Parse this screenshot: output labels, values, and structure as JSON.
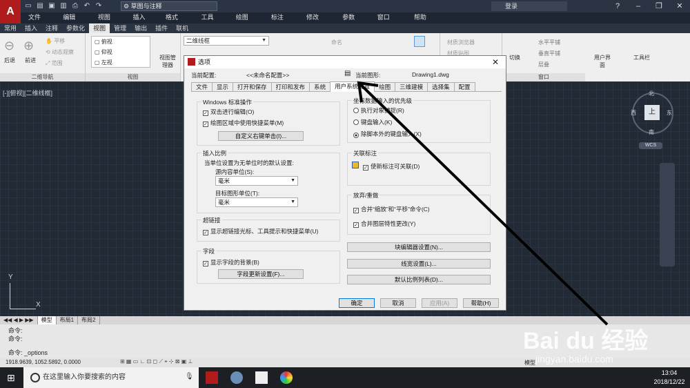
{
  "app": {
    "logo": "A",
    "workspace": "草图与注释",
    "login": "登录",
    "help": "?"
  },
  "menu": [
    "文件(F)",
    "编辑(E)",
    "视图(V)",
    "插入(I)",
    "格式(O)",
    "工具(T)",
    "绘图(D)",
    "标注(N)",
    "修改(M)",
    "参数(P)",
    "窗口(W)",
    "帮助(H)"
  ],
  "ribbon_tabs": [
    "常用",
    "插入",
    "注释",
    "参数化",
    "视图",
    "管理",
    "输出",
    "插件",
    "联机"
  ],
  "ribbon_active": "视图",
  "ribbon": {
    "nav_back": "后退",
    "nav_fwd": "前进",
    "pan": "平移",
    "orbit": "动态观察",
    "range": "范围",
    "panel_nav": "二维导航",
    "view_top": "俯视",
    "view_bottom": "仰视",
    "view_left": "左视",
    "view_mgr": "视图管理器",
    "panel_view": "视图",
    "visual_style": "二维线框",
    "named": "命名",
    "mat_browser": "材质浏览器",
    "mat_map": "材质贴图",
    "switch": "切换",
    "horiz": "水平平铺",
    "vert": "垂直平铺",
    "cascade": "层叠",
    "user_iface": "用户界面",
    "toolbar": "工具栏",
    "panel_window": "窗口"
  },
  "viewport": {
    "label": "[-][俯视][二维线框]",
    "north": "北",
    "south": "南",
    "east": "东",
    "west": "西",
    "cube": "上",
    "wcs": "WCS",
    "ucs_y": "Y",
    "ucs_x": "X"
  },
  "layout_tabs": [
    "模型",
    "布局1",
    "布局2"
  ],
  "commands": [
    "命令:",
    "命令:",
    "命令:  _options"
  ],
  "status": {
    "coords": "1918.9639,  1052.5892,  0.0000",
    "model": "模型"
  },
  "taskbar": {
    "search": "在这里输入你要搜索的内容",
    "time": "13:04",
    "date": "2018/12/22"
  },
  "watermark": {
    "brand": "Bai du 经验",
    "url": "jingyan.baidu.com"
  },
  "dialog": {
    "title": "选项",
    "current_profile_label": "当前配置:",
    "current_profile": "<<未命名配置>>",
    "current_drawing_label": "当前图形:",
    "current_drawing": "Drawing1.dwg",
    "tabs": [
      "文件",
      "显示",
      "打开和保存",
      "打印和发布",
      "系统",
      "用户系统配置",
      "绘图",
      "三维建模",
      "选择集",
      "配置"
    ],
    "active_tab": "用户系统配置",
    "windows_group": "Windows 标准操作",
    "dblclick": "双击进行编辑(O)",
    "shortcut": "绘图区域中使用快捷菜单(M)",
    "rightclick_btn": "自定义右键单击(I)...",
    "insert_group": "插入比例",
    "insert_desc": "当单位设置为无单位时的默认设置:",
    "src_unit_label": "源内容单位(S):",
    "src_unit": "毫米",
    "tgt_unit_label": "目标图形单位(T):",
    "tgt_unit": "毫米",
    "hyperlink_group": "超链接",
    "hyperlink_cb": "显示超链接光标、工具提示和快捷菜单(U)",
    "field_group": "字段",
    "field_cb": "显示字段的背景(B)",
    "field_btn": "字段更新设置(F)...",
    "coord_group": "坐标数据输入的优先级",
    "coord_r1": "执行对象捕捉(R)",
    "coord_r2": "键盘输入(K)",
    "coord_r3": "除脚本外的键盘输入(X)",
    "assoc_group": "关联标注",
    "assoc_cb": "使新标注可关联(D)",
    "undo_group": "放弃/重做",
    "undo_cb1": "合并“缩放”和“平移”命令(C)",
    "undo_cb2": "合并图层特性更改(Y)",
    "block_btn": "块编辑器设置(N)...",
    "lw_btn": "线宽设置(L)...",
    "scale_btn": "默认比例列表(D)...",
    "ok": "确定",
    "cancel": "取消",
    "apply": "应用(A)",
    "help": "帮助(H)"
  }
}
